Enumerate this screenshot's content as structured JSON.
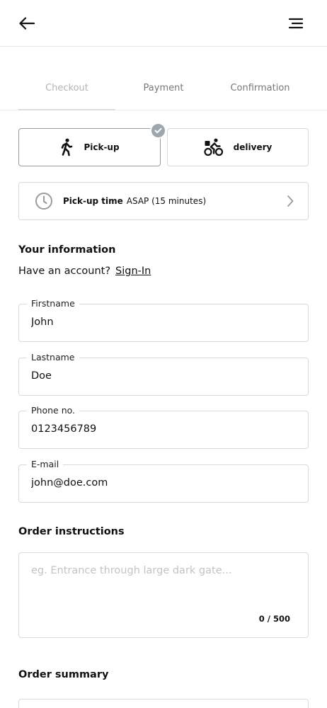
{
  "header": {
    "back_icon": "arrow-left-icon",
    "menu_icon": "menu-icon"
  },
  "tabs": [
    {
      "label": "Checkout",
      "active": true
    },
    {
      "label": "Payment",
      "active": false
    },
    {
      "label": "Confirmation",
      "active": false
    }
  ],
  "fulfillment": {
    "pickup_label": "Pick-up",
    "pickup_icon": "walking-person-icon",
    "delivery_label": "delivery",
    "delivery_icon": "cyclist-icon",
    "selected": "Pick-up",
    "selected_badge_icon": "checkmark-icon"
  },
  "pickup_time": {
    "label": "Pick-up time",
    "value": "ASAP (15 minutes)",
    "icon": "clock-icon",
    "chevron_icon": "chevron-right-icon"
  },
  "your_information": {
    "title": "Your information",
    "account_prompt": "Have an account?",
    "signin_label": "Sign-In"
  },
  "fields": {
    "firstname": {
      "label": "Firstname",
      "value": "John"
    },
    "lastname": {
      "label": "Lastname",
      "value": "Doe"
    },
    "phone": {
      "label": "Phone no.",
      "value": "0123456789"
    },
    "email": {
      "label": "E-mail",
      "value": "john@doe.com"
    }
  },
  "order_instructions": {
    "title": "Order instructions",
    "placeholder": "eg. Entrance through large dark gate...",
    "counter": "0 / 500"
  },
  "order_summary": {
    "title": "Order summary"
  },
  "colors": {
    "border": "#dadada",
    "selected_border": "#9a9a9a",
    "badge": "#9ea7ad",
    "muted_text": "#777777"
  }
}
